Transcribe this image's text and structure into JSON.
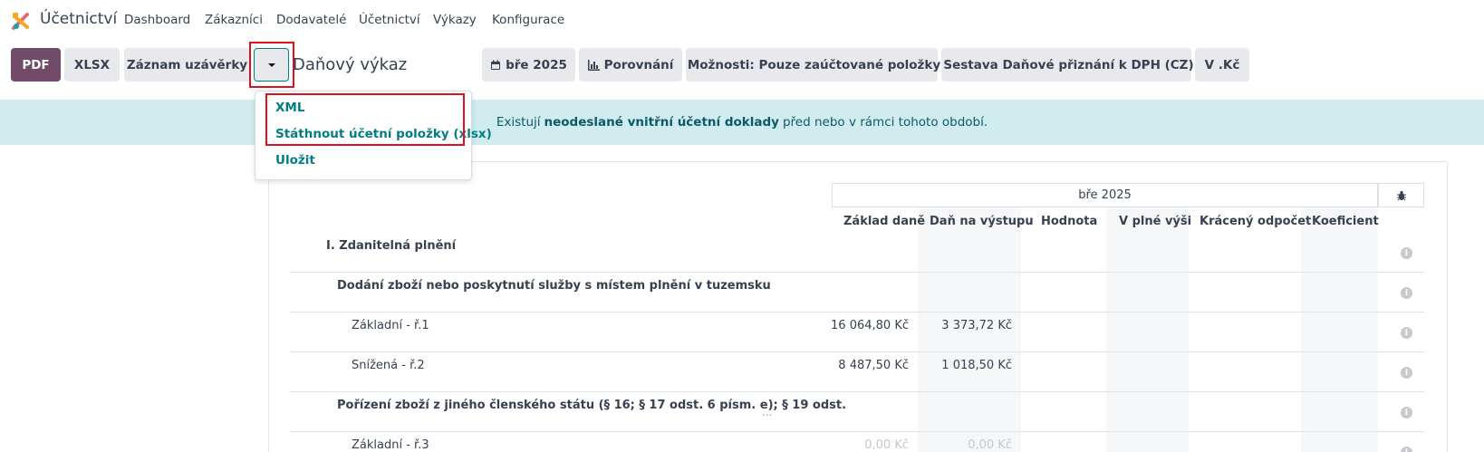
{
  "app": {
    "name": "Účetnictví",
    "nav": [
      "Dashboard",
      "Zákazníci",
      "Dodavatelé",
      "Účetnictví",
      "Výkazy",
      "Konfigurace"
    ]
  },
  "toolbar": {
    "pdf": "PDF",
    "xlsx": "XLSX",
    "closing_entry": "Záznam uzávěrky",
    "breadcrumb": "Daňový výkaz",
    "period": "bře 2025",
    "comparison": "Porovnání",
    "options": "Možnosti: Pouze zaúčtované položky",
    "report": "Sestava Daňové přiznání k DPH (CZ)",
    "currency": "V .Kč"
  },
  "dropdown": {
    "items": [
      "XML",
      "Státhnout účetní položky (xlsx)",
      "Uložit"
    ]
  },
  "banner": {
    "before": "Existují",
    "bold": "neodeslané vnitřní účetní doklady",
    "after": "před nebo v rámci tohoto období."
  },
  "report": {
    "period_header": "bře 2025",
    "columns": [
      "Základ daně",
      "Daň na výstupu",
      "Hodnota",
      "V plné výši",
      "Krácený odpočet",
      "Koeficient"
    ],
    "rows": [
      {
        "label": "I. Zdanitelná plnění",
        "base": "",
        "tax": ""
      },
      {
        "label": "Dodání zboží nebo poskytnutí služby s místem plnění v tuzemsku",
        "base": "",
        "tax": ""
      },
      {
        "label": "Základní - ř.1",
        "base": "16 064,80 Kč",
        "tax": "3 373,72 Kč"
      },
      {
        "label": "Snížená - ř.2",
        "base": "8 487,50 Kč",
        "tax": "1 018,50 Kč"
      },
      {
        "label": "Pořízení zboží z jiného členského státu (§ 16; § 17 odst. 6 písm. e); § 19 odst.",
        "base": "",
        "tax": ""
      },
      {
        "label": "Základní - ř.3",
        "base": "0,00 Kč",
        "tax": "0,00 Kč"
      }
    ],
    "ellipsis": "..."
  },
  "colors": {
    "primary": "#714B67",
    "accent": "#017e84",
    "highlight": "#e0101e",
    "banner": "#d0ecef"
  }
}
